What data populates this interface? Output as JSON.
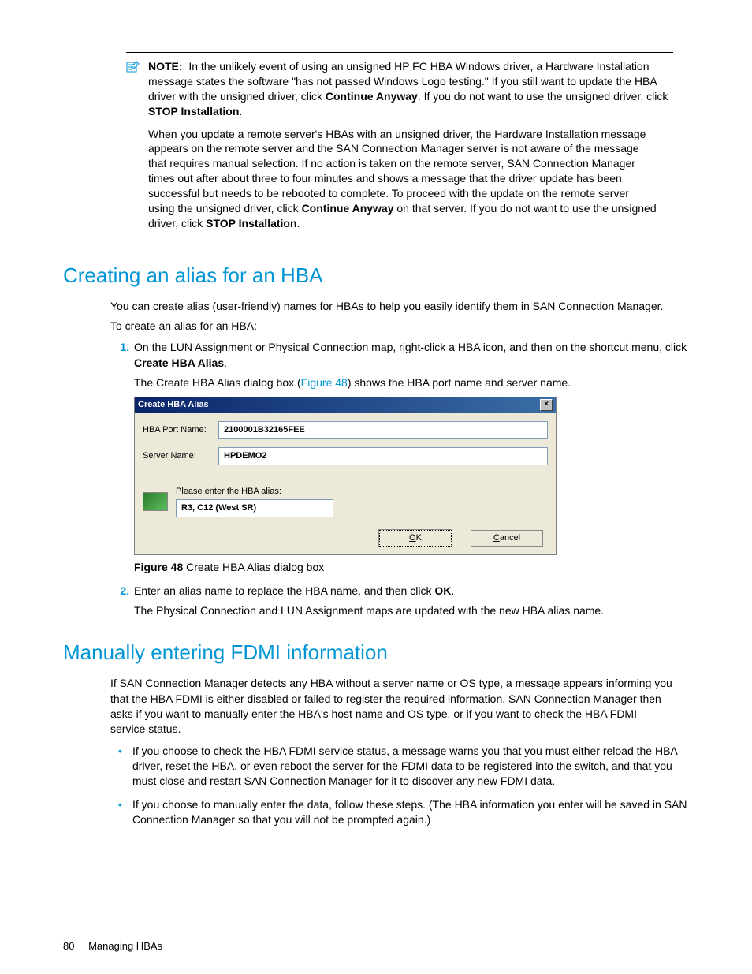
{
  "note": {
    "label": "NOTE:",
    "p1_a": "In the unlikely event of using an unsigned HP FC HBA Windows driver, a Hardware Installation message states the software \"has not passed Windows Logo testing.\" If you still want to update the HBA driver with the unsigned driver, click ",
    "p1_b1": "Continue Anyway",
    "p1_c": ". If you do not want to use the unsigned driver, click ",
    "p1_b2": "STOP Installation",
    "p1_d": ".",
    "p2_a": "When you update a remote server's HBAs with an unsigned driver, the Hardware Installation message appears on the remote server and the SAN Connection Manager server is not aware of the message that requires manual selection. If no action is taken on the remote server, SAN Connection Manager times out after about three to four minutes and shows a message that the driver update has been successful but needs to be rebooted to complete. To proceed with the update on the remote server using the unsigned driver, click ",
    "p2_b1": "Continue Anyway",
    "p2_c": " on that server. If you do not want to use the unsigned driver, click ",
    "p2_b2": "STOP Installation",
    "p2_d": "."
  },
  "h_create": "Creating an alias for an HBA",
  "create_intro": "You can create alias (user-friendly) names for HBAs to help you easily identify them in SAN Connection Manager.",
  "create_lead": "To create an alias for an HBA:",
  "step1_a": "On the LUN Assignment or Physical Connection map, right-click a HBA icon, and then on the shortcut menu, click ",
  "step1_b": "Create HBA Alias",
  "step1_c": ".",
  "step1_after_a": "The Create HBA Alias dialog box (",
  "step1_after_ref": "Figure 48",
  "step1_after_b": ") shows the HBA port name and server name.",
  "dialog": {
    "title": "Create HBA Alias",
    "close": "×",
    "port_label": "HBA Port Name:",
    "port_value": "2100001B32165FEE",
    "server_label": "Server Name:",
    "server_value": "HPDEMO2",
    "alias_prompt": "Please enter the HBA alias:",
    "alias_value": "R3, C12 (West SR)",
    "ok_u": "O",
    "ok_rest": "K",
    "cancel_u": "C",
    "cancel_rest": "ancel"
  },
  "fig48_label": "Figure 48",
  "fig48_text": " Create HBA Alias dialog box",
  "step2_a": "Enter an alias name to replace the HBA name, and then click ",
  "step2_b": "OK",
  "step2_c": ".",
  "step2_after": "The Physical Connection and LUN Assignment maps are updated with the new HBA alias name.",
  "h_fdmi": "Manually entering FDMI information",
  "fdmi_intro": "If SAN Connection Manager detects any HBA without a server name or OS type, a message appears informing you that the HBA FDMI is either disabled or failed to register the required information. SAN Connection Manager then asks if you want to manually enter the HBA's host name and OS type, or if you want to check the HBA FDMI service status.",
  "fdmi_b1": "If you choose to check the HBA FDMI service status, a message warns you that you must either reload the HBA driver, reset the HBA, or even reboot the server for the FDMI data to be registered into the switch, and that you must close and restart SAN Connection Manager for it to discover any new FDMI data.",
  "fdmi_b2": "If you choose to manually enter the data, follow these steps. (The HBA information you enter will be saved in SAN Connection Manager so that you will not be prompted again.)",
  "footer": {
    "page": "80",
    "section": "Managing HBAs"
  }
}
